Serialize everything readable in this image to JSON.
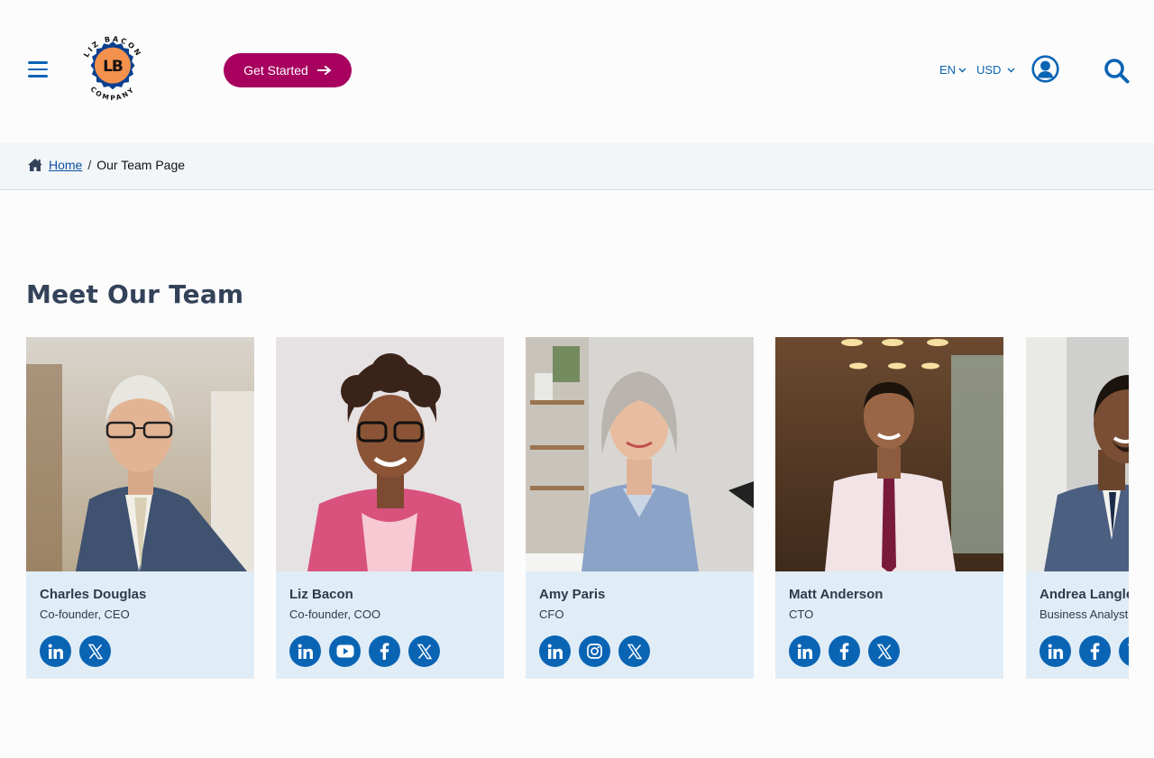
{
  "header": {
    "menu_icon": "hamburger-menu-icon",
    "logo": {
      "top_text": "LIZ BACON",
      "monogram": "LB",
      "bottom_text": "COMPANY"
    },
    "cta_label": "Get Started",
    "language": "EN",
    "currency": "USD",
    "user_icon": "user-circle-icon",
    "search_icon": "search-icon"
  },
  "breadcrumb": {
    "home_label": "Home",
    "separator": "/",
    "current": "Our Team Page"
  },
  "main": {
    "title": "Meet Our Team",
    "team": [
      {
        "name": "Charles Douglas",
        "role": "Co-founder, CEO",
        "socials": [
          "linkedin",
          "x"
        ]
      },
      {
        "name": "Liz Bacon",
        "role": "Co-founder, COO",
        "socials": [
          "linkedin",
          "youtube",
          "facebook",
          "x"
        ]
      },
      {
        "name": "Amy Paris",
        "role": "CFO",
        "socials": [
          "linkedin",
          "instagram",
          "x"
        ]
      },
      {
        "name": "Matt Anderson",
        "role": "CTO",
        "socials": [
          "linkedin",
          "facebook",
          "x"
        ]
      },
      {
        "name": "Andrea Langley",
        "role": "Business Analyst",
        "socials": [
          "linkedin",
          "facebook",
          "x"
        ]
      }
    ]
  },
  "colors": {
    "brand_blue": "#0a64b4",
    "cta_magenta": "#a7005e",
    "card_bg": "#e0edf7",
    "breadcrumb_bg": "#f2f6f8",
    "logo_orange": "#f3914d"
  }
}
